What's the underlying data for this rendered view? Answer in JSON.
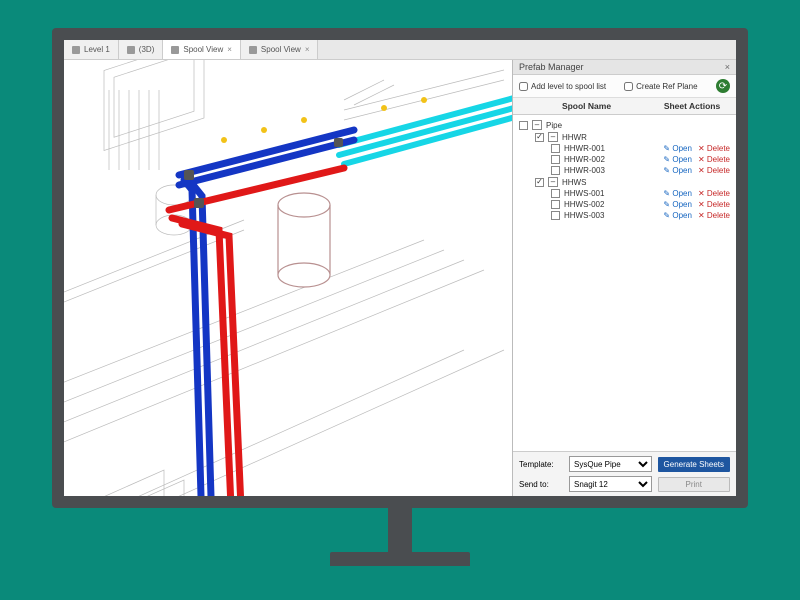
{
  "tabs": [
    {
      "label": "Level 1",
      "active": false
    },
    {
      "label": "(3D)",
      "active": false
    },
    {
      "label": "Spool View",
      "active": true
    },
    {
      "label": "Spool View",
      "active": false
    }
  ],
  "panel": {
    "title": "Prefab Manager",
    "opt_add_level": "Add level to spool list",
    "opt_ref_plane": "Create Ref Plane",
    "header_name": "Spool Name",
    "header_actions": "Sheet Actions",
    "root_label": "Pipe",
    "groups": [
      {
        "name": "HHWR",
        "checked": true,
        "items": [
          {
            "name": "HHWR-001"
          },
          {
            "name": "HHWR-002"
          },
          {
            "name": "HHWR-003"
          }
        ]
      },
      {
        "name": "HHWS",
        "checked": true,
        "items": [
          {
            "name": "HHWS-001"
          },
          {
            "name": "HHWS-002"
          },
          {
            "name": "HHWS-003"
          }
        ]
      }
    ],
    "action_open": "Open",
    "action_delete": "Delete",
    "template_label": "Template:",
    "template_value": "SysQue Pipe",
    "sendto_label": "Send to:",
    "sendto_value": "Snagit 12",
    "generate_button": "Generate Sheets",
    "print_button": "Print"
  }
}
